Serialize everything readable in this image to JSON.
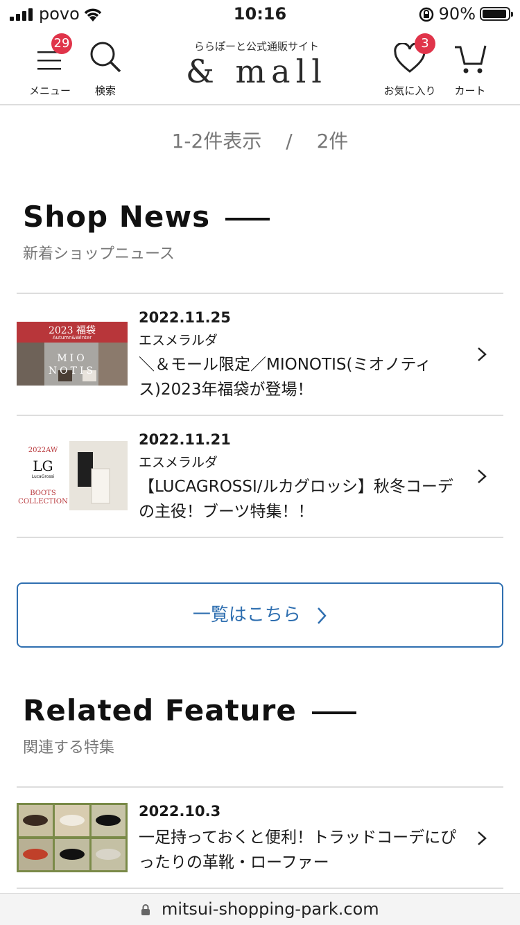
{
  "status": {
    "carrier": "povo",
    "time": "10:16",
    "battery": "90%"
  },
  "header": {
    "menu_label": "メニュー",
    "menu_badge": "29",
    "search_label": "検索",
    "brand_sub": "ららぽーと公式通販サイト",
    "brand": "& mall",
    "fav_label": "お気に入り",
    "fav_badge": "3",
    "cart_label": "カート"
  },
  "results": {
    "range": "1-2件表示",
    "separator": "/",
    "total": "2件"
  },
  "shop_news": {
    "title": "Shop News",
    "subtitle": "新着ショップニュース",
    "items": [
      {
        "date": "2022.11.25",
        "shop": "エスメラルダ",
        "title": "＼＆モール限定／MIONOTIS(ミオノティス)2023年福袋が登場！",
        "thumb_text_top": "2023 福袋",
        "thumb_text_sub": "Autumn&Winter",
        "thumb_text_brand": "MIO NOTIS"
      },
      {
        "date": "2022.11.21",
        "shop": "エスメラルダ",
        "title": "【LUCAGROSSI/ルカグロッシ】秋冬コーデの主役！ブーツ特集！！",
        "thumb_text_year": "2022AW",
        "thumb_text_logo": "LG",
        "thumb_text_brand": "LucaGrossi",
        "thumb_text_boots": "BOOTS",
        "thumb_text_collection": "COLLECTION"
      }
    ],
    "list_button": "一覧はこちら"
  },
  "related": {
    "title": "Related Feature",
    "subtitle": "関連する特集",
    "items": [
      {
        "date": "2022.10.3",
        "title": "一足持っておくと便利！トラッドコーデにぴったりの革靴・ローファー"
      }
    ]
  },
  "urlbar": {
    "url": "mitsui-shopping-park.com"
  },
  "colors": {
    "badge": "#e0344a",
    "link": "#2f6fb0"
  }
}
